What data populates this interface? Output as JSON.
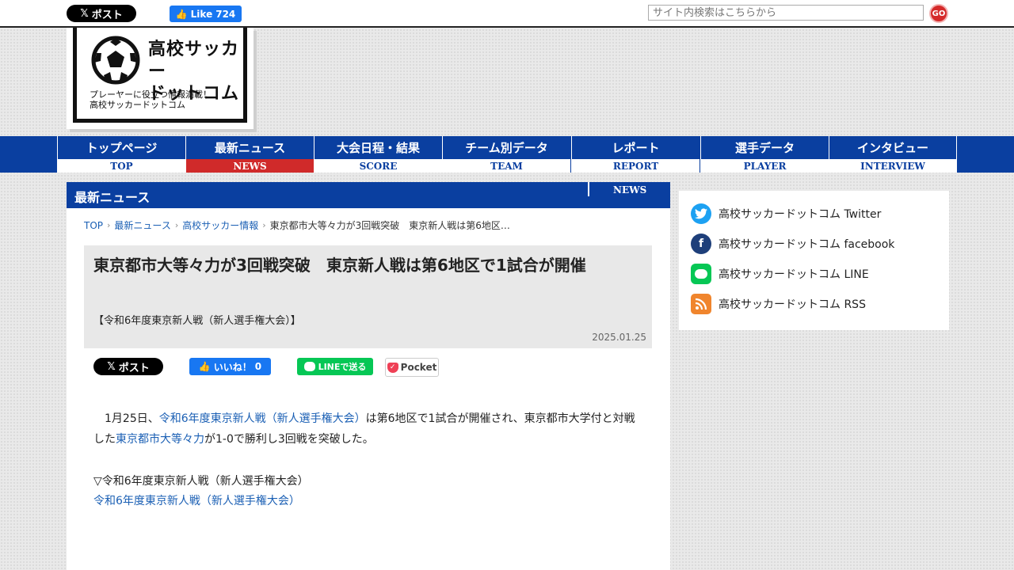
{
  "topbar": {
    "x_post_label": "ポスト",
    "fb_like_label": "Like",
    "fb_like_count": "724",
    "search_placeholder": "サイト内検索はこちらから",
    "go_label": "GO"
  },
  "logo": {
    "title_line1": "高校サッカー",
    "title_line2": "ドットコム",
    "tagline_line1": "プレーヤーに役立つ情報満載！",
    "tagline_line2": "高校サッカードットコム"
  },
  "nav": {
    "items": [
      {
        "jp": "トップページ",
        "en": "TOP"
      },
      {
        "jp": "最新ニュース",
        "en": "NEWS"
      },
      {
        "jp": "大会日程・結果",
        "en": "SCORE"
      },
      {
        "jp": "チーム別データ",
        "en": "TEAM"
      },
      {
        "jp": "レポート",
        "en": "REPORT"
      },
      {
        "jp": "選手データ",
        "en": "PLAYER"
      },
      {
        "jp": "インタビュー",
        "en": "INTERVIEW"
      }
    ],
    "active_index": 1
  },
  "main": {
    "section_title": "最新ニュース",
    "section_en": "NEWS",
    "breadcrumb": [
      "TOP",
      "最新ニュース",
      "高校サッカー情報",
      "東京都市大等々力が3回戦突破　東京新人戦は第6地区…"
    ],
    "article": {
      "title": "東京都市大等々力が3回戦突破　東京新人戦は第6地区で1試合が開催",
      "subtitle": "【令和6年度東京新人戦（新人選手権大会）】",
      "date": "2025.01.25"
    },
    "share": {
      "x_label": "ポスト",
      "fb_label": "いいね！",
      "fb_count": "0",
      "line_label": "LINEで送る",
      "pocket_label": "Pocket"
    },
    "body": {
      "p1_a": "1月25日、",
      "p1_link1": "令和6年度東京新人戦（新人選手権大会）",
      "p1_b": "は第6地区で1試合が開催され、東京都市大学付と対戦した",
      "p1_link2": "東京都市大等々力",
      "p1_c": "が1-0で勝利し3回戦を突破した。"
    },
    "related": {
      "heading": "▽令和6年度東京新人戦（新人選手権大会）",
      "link": "令和6年度東京新人戦（新人選手権大会）"
    }
  },
  "sidebar": {
    "links": [
      {
        "label": "高校サッカードットコム Twitter",
        "icon": "twitter-icon",
        "color": "#1da1f2"
      },
      {
        "label": "高校サッカードットコム facebook",
        "icon": "facebook-icon",
        "color": "#1e3f7a"
      },
      {
        "label": "高校サッカードットコム LINE",
        "icon": "line-icon",
        "color": "#06c755"
      },
      {
        "label": "高校サッカードットコム RSS",
        "icon": "rss-icon",
        "color": "#f0852d"
      }
    ]
  },
  "colors": {
    "brand_blue": "#0a3fa0",
    "active_red": "#d02a2a",
    "link_blue": "#1a5fb4"
  }
}
